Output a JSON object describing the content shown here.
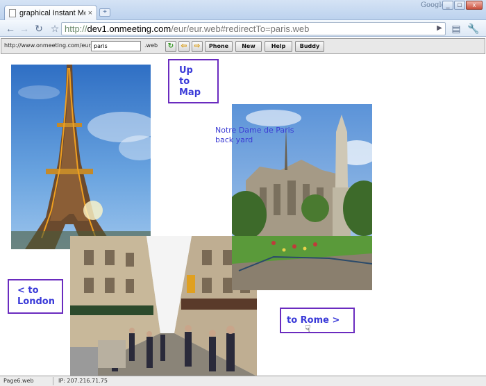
{
  "browser": {
    "tab_title": "graphical Instant Mes...",
    "tab_close": "×",
    "new_tab": "+",
    "brand": "Google",
    "url_scheme": "http://",
    "url_host": "dev1.onmeeting.com",
    "url_path": "/eur/eur.web#redirectTo=paris.web",
    "back_icon": "back-arrow-icon",
    "forward_icon": "forward-arrow-icon",
    "reload_icon": "reload-icon",
    "bookmark_icon": "star-icon"
  },
  "appbar": {
    "base_url": "http://www.onmeeting.com/eur/",
    "city_value": "paris",
    "extension": ".web",
    "buttons": {
      "phone": "Phone",
      "new": "New",
      "help": "Help",
      "buddy": "Buddy"
    }
  },
  "content": {
    "up_to_map_line1": "Up",
    "up_to_map_line2": "to Map",
    "to_london_line1": "< to",
    "to_london_line2": "London",
    "to_rome": "to Rome >",
    "caption_line1": "Notre Dame de Paris",
    "caption_line2": "back yard"
  },
  "status": {
    "page": "Page6.web",
    "ip": "IP: 207.216.71.75"
  },
  "colors": {
    "link_text": "#3a3ad8",
    "link_border": "#6a2bbf",
    "caption": "#3b3bd4"
  }
}
